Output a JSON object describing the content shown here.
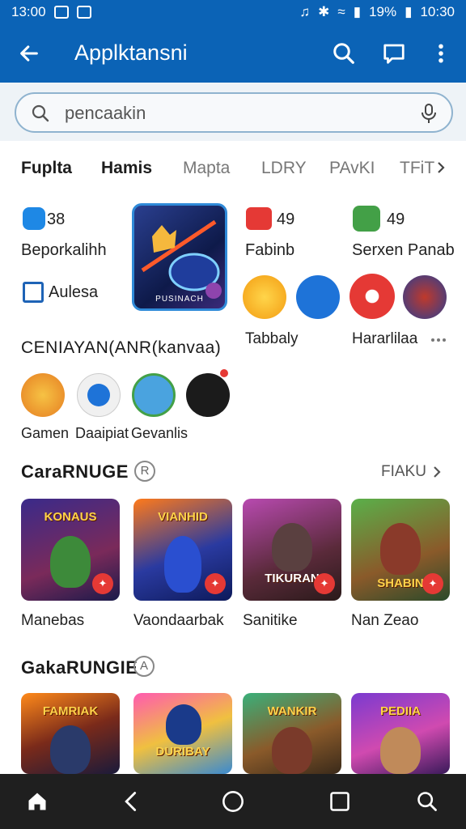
{
  "status_bar": {
    "time_left": "13:00",
    "battery": "19%",
    "time_right": "10:30"
  },
  "app_bar": {
    "title": "Applktansni"
  },
  "search": {
    "placeholder": "pencaakin"
  },
  "tabs": [
    {
      "label": "Fuplta",
      "active": true
    },
    {
      "label": "Hamis",
      "active": true
    },
    {
      "label": "Mapta",
      "active": false
    },
    {
      "label": "LDRY",
      "active": false
    },
    {
      "label": "PAvKI",
      "active": false
    },
    {
      "label": "TFiT",
      "active": false
    }
  ],
  "top_grid": {
    "item1": {
      "count": "38",
      "label": "Beporkalihh"
    },
    "item2": {
      "label": "Aulesa"
    },
    "featured_caption": "PUSINACH",
    "item3": {
      "count": "49",
      "label": "Fabinb"
    },
    "item4": {
      "count": "49",
      "label": "Serxen Panab"
    },
    "row_labels": {
      "left": "Tabbaly",
      "right": "Hararlilaa"
    },
    "more_icon": "more-horizontal-icon"
  },
  "section1": {
    "title": "CENIAYAN(ANR(kanvaa)",
    "items": [
      {
        "label": "Gamen"
      },
      {
        "label": "Daaipiat"
      },
      {
        "label": "Gevanlis"
      }
    ]
  },
  "section2": {
    "title": "CaraRNUGE",
    "badge": "R",
    "see_more": "FIAKU",
    "cards": [
      {
        "title": "KONAUS",
        "label": "Manebas"
      },
      {
        "title": "VIANHID",
        "label": "Vaondaarbak"
      },
      {
        "title": "TIKURAN",
        "label": "Sanitike"
      },
      {
        "title": "SHABIN",
        "label": "Nan Zeao"
      }
    ]
  },
  "section3": {
    "title": "GakaRUNGIE",
    "badge": "A",
    "cards": [
      {
        "title": "FAMRIAK"
      },
      {
        "title": "DURIBAY"
      },
      {
        "title": "WANKIR"
      },
      {
        "title": "PEDIIA"
      }
    ]
  },
  "colors": {
    "primary": "#0b63b6",
    "nav": "#1f1f1f",
    "accent_red": "#e53935"
  }
}
